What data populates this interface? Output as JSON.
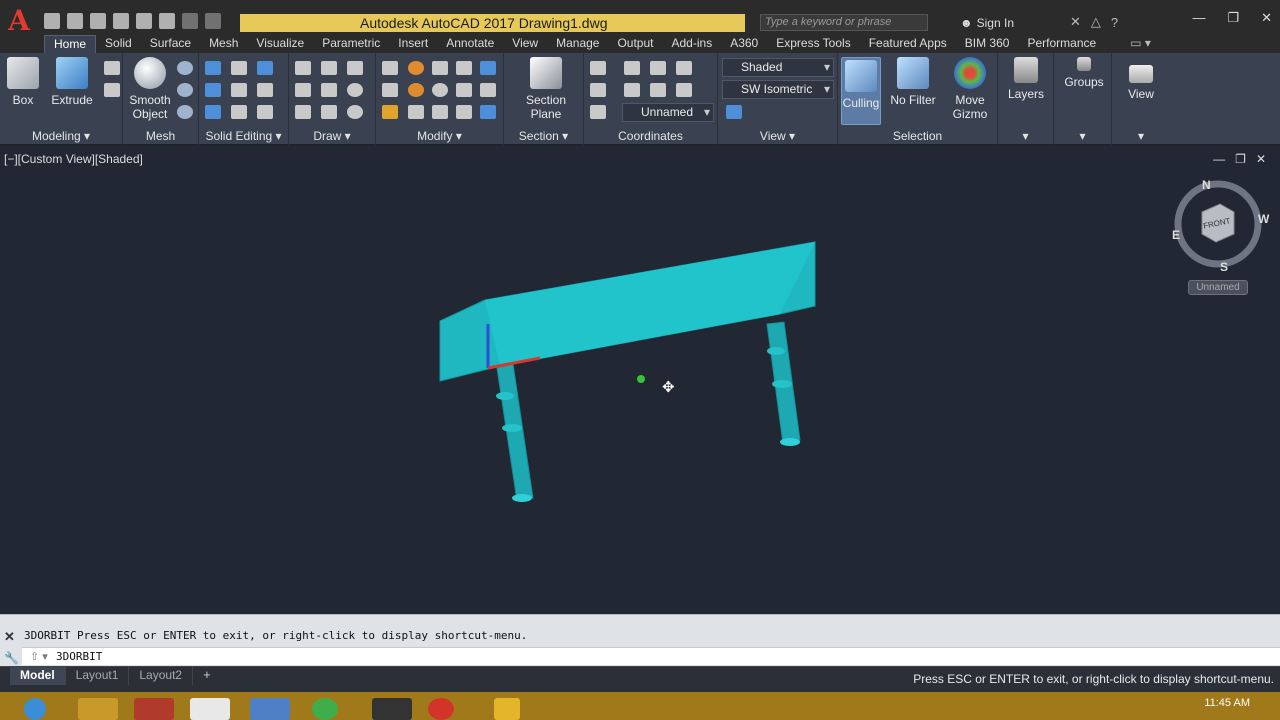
{
  "titlebar": {
    "app_title": "Autodesk AutoCAD 2017    Drawing1.dwg",
    "search_placeholder": "Type a keyword or phrase",
    "sign_in": "Sign In",
    "logo": "A"
  },
  "ribbon_tabs": [
    "Home",
    "Solid",
    "Surface",
    "Mesh",
    "Visualize",
    "Parametric",
    "Insert",
    "Annotate",
    "View",
    "Manage",
    "Output",
    "Add-ins",
    "A360",
    "Express Tools",
    "Featured Apps",
    "BIM 360",
    "Performance"
  ],
  "ribbon": {
    "modeling": {
      "label": "Modeling ▾",
      "box": "Box",
      "extrude": "Extrude"
    },
    "mesh": {
      "label": "Mesh",
      "smooth": "Smooth",
      "object": "Object"
    },
    "solid_editing": {
      "label": "Solid Editing ▾"
    },
    "draw": {
      "label": "Draw ▾"
    },
    "modify": {
      "label": "Modify ▾"
    },
    "section": {
      "label": "Section ▾",
      "plane1": "Section",
      "plane2": "Plane"
    },
    "coordinates": {
      "label": "Coordinates",
      "ucs": "Unnamed"
    },
    "view": {
      "label": "View ▾",
      "visual_style": "Shaded",
      "view_name": "SW Isometric"
    },
    "selection": {
      "label": "Selection",
      "culling": "Culling",
      "no_filter": "No Filter",
      "move": "Move",
      "gizmo": "Gizmo"
    },
    "layers": {
      "label": "Layers"
    },
    "groups": {
      "label": "Groups"
    },
    "view_panel": {
      "label": "View"
    }
  },
  "viewport": {
    "label": "[−][Custom View][Shaded]",
    "viewcube_face": "FRONT",
    "compass": {
      "n": "N",
      "s": "S",
      "e": "E",
      "w": "W"
    },
    "named_view": "Unnamed"
  },
  "command": {
    "history": "3DORBIT Press ESC or ENTER to exit, or right-click to display shortcut-menu.",
    "input": "3DORBIT"
  },
  "layout_tabs": [
    "Model",
    "Layout1",
    "Layout2"
  ],
  "status_message": "Press ESC or ENTER to exit, or right-click to display shortcut-menu.",
  "clock": "11:45 AM",
  "colors": {
    "model": "#1fb8c1",
    "ribbon": "#3a4150",
    "viewport": "#212834",
    "title_strip": "#e7c95a"
  }
}
